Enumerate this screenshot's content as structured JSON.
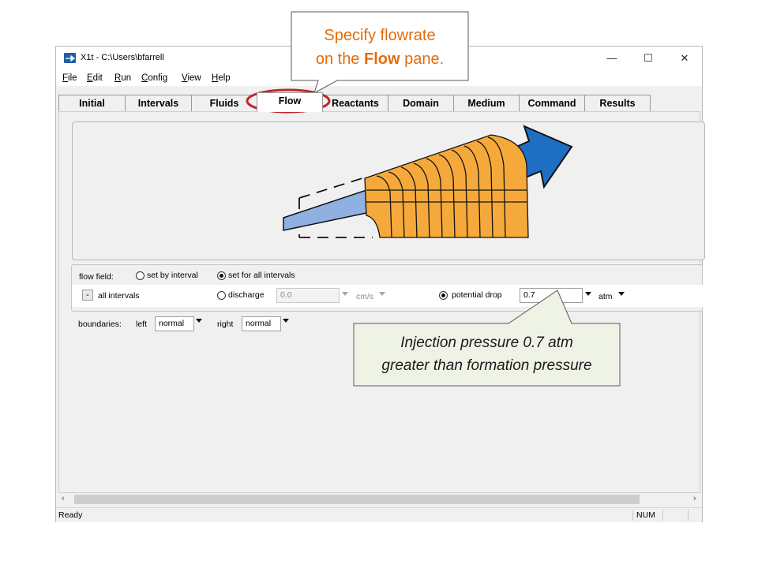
{
  "window": {
    "title": "X1t - C:\\Users\\bfarrell",
    "controls": {
      "minimize": "—",
      "maximize": "☐",
      "close": "✕"
    }
  },
  "menu": [
    {
      "label": "File"
    },
    {
      "label": "Edit"
    },
    {
      "label": "Run"
    },
    {
      "label": "Config"
    },
    {
      "label": "View"
    },
    {
      "label": "Help"
    }
  ],
  "tabs": [
    {
      "label": "Initial"
    },
    {
      "label": "Intervals"
    },
    {
      "label": "Fluids"
    },
    {
      "label": "Flow",
      "active": true
    },
    {
      "label": "Reactants"
    },
    {
      "label": "Domain"
    },
    {
      "label": "Medium"
    },
    {
      "label": "Command"
    },
    {
      "label": "Results"
    }
  ],
  "flow_field": {
    "label": "flow field:",
    "opt_by_interval": "set by interval",
    "opt_all_intervals": "set for all intervals",
    "selected": "set for all intervals",
    "minus_label": "-",
    "all_intervals_label": "all intervals",
    "discharge_label": "discharge",
    "discharge_value": "0.0",
    "discharge_unit": "cm/s",
    "potential_drop_label": "potential drop",
    "potential_drop_value": "0.7",
    "potential_drop_unit": "atm",
    "selected_mode": "potential drop"
  },
  "boundaries": {
    "label": "boundaries:",
    "left_label": "left",
    "left_value": "normal",
    "right_label": "right",
    "right_value": "normal"
  },
  "status": {
    "text": "Ready",
    "num": "NUM"
  },
  "callouts": {
    "top_line1": "Specify flowrate",
    "top_line2_pre": "on the ",
    "top_line2_bold": "Flow",
    "top_line2_post": " pane.",
    "bottom_line1": "Injection pressure 0.7 atm",
    "bottom_line2": "greater than formation pressure"
  },
  "colors": {
    "callout_top_text": "#e46c0a",
    "highlight_ring": "#c0272d",
    "cylinder_fill": "#f6a93b",
    "arrow_blue": "#1e6fc4",
    "probe_blue": "#8fb0e0"
  }
}
